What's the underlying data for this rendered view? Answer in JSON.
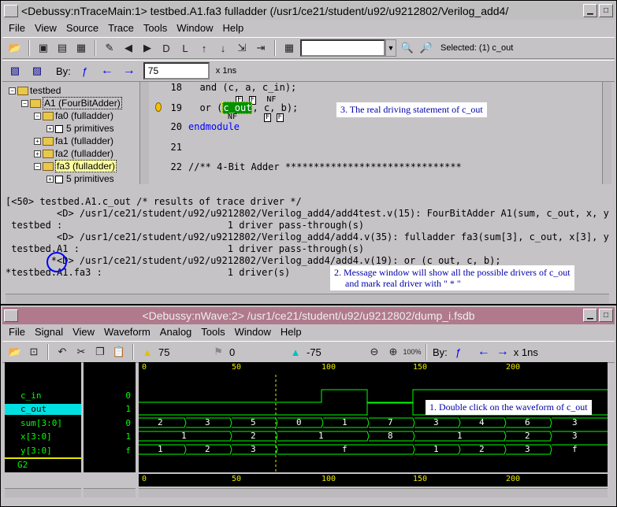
{
  "win1": {
    "title": "<Debussy:nTraceMain:1> testbed.A1.fa3 fulladder (/usr1/ce21/student/u92/u9212802/Verilog_add4/",
    "menu": [
      "File",
      "View",
      "Source",
      "Trace",
      "Tools",
      "Window",
      "Help"
    ],
    "selected_label": "Selected: (1) c_out",
    "by_label": "By:",
    "time_value": "75",
    "time_unit": "x 1ns",
    "tree": {
      "root": "testbed",
      "a1": "A1 (FourBitAdder)",
      "fa0": "fa0 (fulladder)",
      "prim0": "5 primitives",
      "fa1": "fa1 (fulladder)",
      "fa2": "fa2 (fulladder)",
      "fa3": "fa3 (fulladder)",
      "prim3": "5 primitives"
    },
    "source": {
      "lines": [
        {
          "num": "18",
          "code": "  and (c, a, c_in);"
        },
        {
          "num": "19",
          "code": "  or (c_out, c, b);"
        },
        {
          "num": "20",
          "code": "endmodule"
        },
        {
          "num": "21",
          "code": ""
        },
        {
          "num": "22",
          "code": "//** 4-Bit Adder *******************************"
        }
      ],
      "tag_f": "F",
      "tag_nf": "NF",
      "annotation": "3. The real driving statement of c_out"
    },
    "messages": [
      "[<50> testbed.A1.c_out /* results of trace driver */",
      "         <D> /usr1/ce21/student/u92/u9212802/Verilog_add4/add4test.v(15): FourBitAdder A1(sum, c_out, x, y,",
      " testbed :                             1 driver pass-through(s)",
      "         <D> /usr1/ce21/student/u92/u9212802/Verilog_add4/add4.v(35): fulladder fa3(sum[3], c_out, x[3], y[",
      " testbed.A1 :                          1 driver pass-through(s)",
      "        *<D> /usr1/ce21/student/u92/u9212802/Verilog_add4/add4.v(19): or (c_out, c, b);",
      "*testbed.A1.fa3 :                      1 driver(s)"
    ],
    "msg_annotation_1": "2. Message window will show all the possible drivers of c_out",
    "msg_annotation_2": "and mark real driver with \" * \""
  },
  "win2": {
    "title": "<Debussy:nWave:2> /usr1/ce21/student/u92/u9212802/dump_i.fsdb",
    "menu": [
      "File",
      "Signal",
      "View",
      "Waveform",
      "Analog",
      "Tools",
      "Window",
      "Help"
    ],
    "cursor_time": "75",
    "marker_time": "0",
    "delta_time": "-75",
    "zoom_label": "100%",
    "by_label": "By:",
    "time_unit": "x 1ns",
    "signals": [
      {
        "name": "c_in",
        "value": "0"
      },
      {
        "name": "c_out",
        "value": "1"
      },
      {
        "name": "sum[3:0]",
        "value": "0"
      },
      {
        "name": "x[3:0]",
        "value": "1"
      },
      {
        "name": "y[3:0]",
        "value": "f"
      }
    ],
    "group_label": "G2",
    "ruler_ticks": [
      "0",
      "50",
      "100",
      "150",
      "200"
    ],
    "sum_values": [
      "2",
      "3",
      "5",
      "0",
      "1",
      "7",
      "3",
      "4",
      "6",
      "3"
    ],
    "x_values": [
      "1",
      "2",
      "1",
      "8",
      "1",
      "2",
      "3"
    ],
    "y_values": [
      "1",
      "2",
      "3",
      "f",
      "1",
      "2",
      "3",
      "f"
    ],
    "annotation": "1. Double click on the waveform of c_out",
    "colors": {
      "wave": "#00ff00",
      "highlight": "#00e0e0",
      "ruler": "#e8e800",
      "annot_text": "#0000aa"
    }
  }
}
